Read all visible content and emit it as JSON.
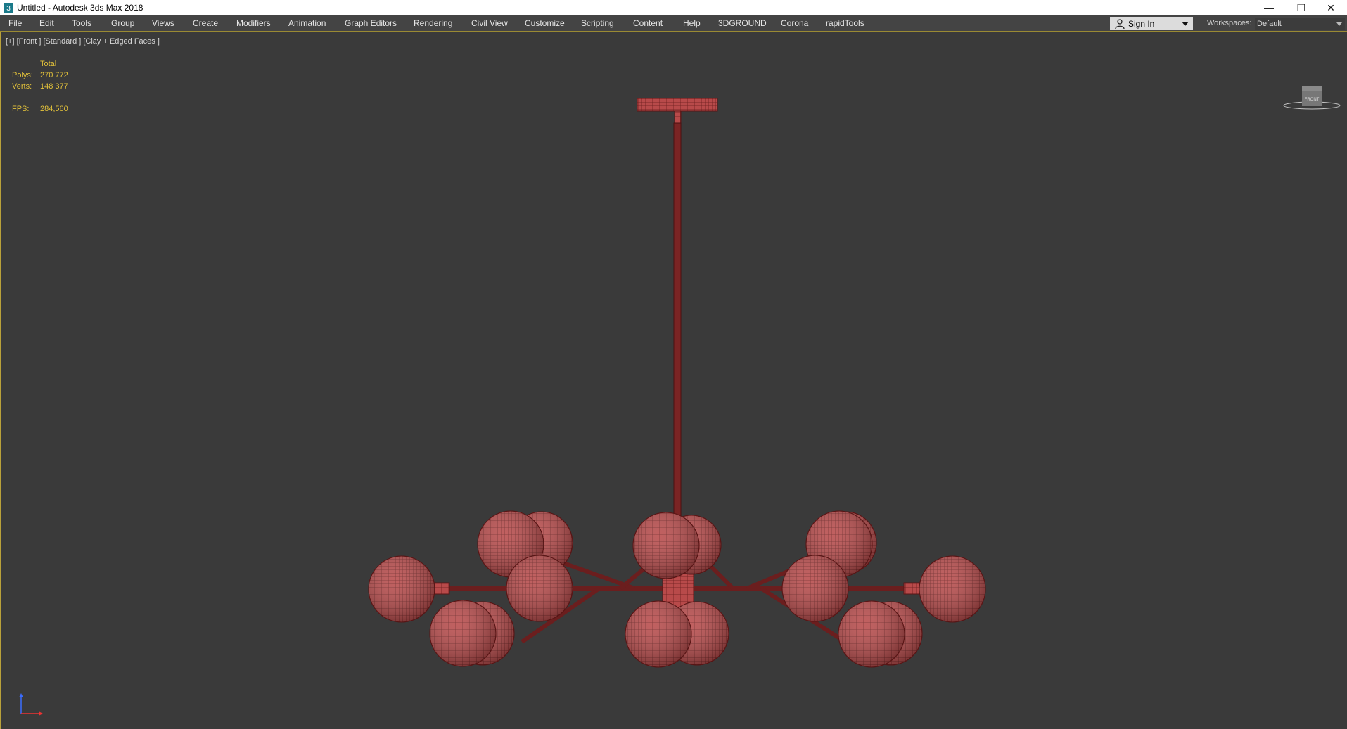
{
  "window": {
    "title": "Untitled - Autodesk 3ds Max 2018",
    "minimize_glyph": "—",
    "restore_glyph": "❐",
    "close_glyph": "✕"
  },
  "menu": {
    "items": [
      {
        "label": "File"
      },
      {
        "label": "Edit"
      },
      {
        "label": "Tools"
      },
      {
        "label": "Group"
      },
      {
        "label": "Views"
      },
      {
        "label": "Create"
      },
      {
        "label": "Modifiers"
      },
      {
        "label": "Animation"
      },
      {
        "label": "Graph Editors"
      },
      {
        "label": "Rendering"
      },
      {
        "label": "Civil View"
      },
      {
        "label": "Customize"
      },
      {
        "label": "Scripting"
      },
      {
        "label": "Content"
      },
      {
        "label": "Help"
      },
      {
        "label": "3DGROUND"
      },
      {
        "label": "Corona"
      },
      {
        "label": "rapidTools"
      }
    ],
    "sign_in": "Sign In",
    "workspaces_label": "Workspaces:",
    "workspace_value": "Default"
  },
  "viewport": {
    "label": "[+] [Front ] [Standard ] [Clay + Edged Faces ]",
    "stats": {
      "header": "Total",
      "polys_label": "Polys:",
      "polys_value": "270 772",
      "verts_label": "Verts:",
      "verts_value": "148 377",
      "fps_label": "FPS:",
      "fps_value": "284,560"
    },
    "viewcube_label": "FRONT"
  },
  "colors": {
    "viewport_bg": "#3a3a3a",
    "model_red": "#b84a4a",
    "wire": "#6a1d1d",
    "stats_yellow": "#e3c23a"
  }
}
